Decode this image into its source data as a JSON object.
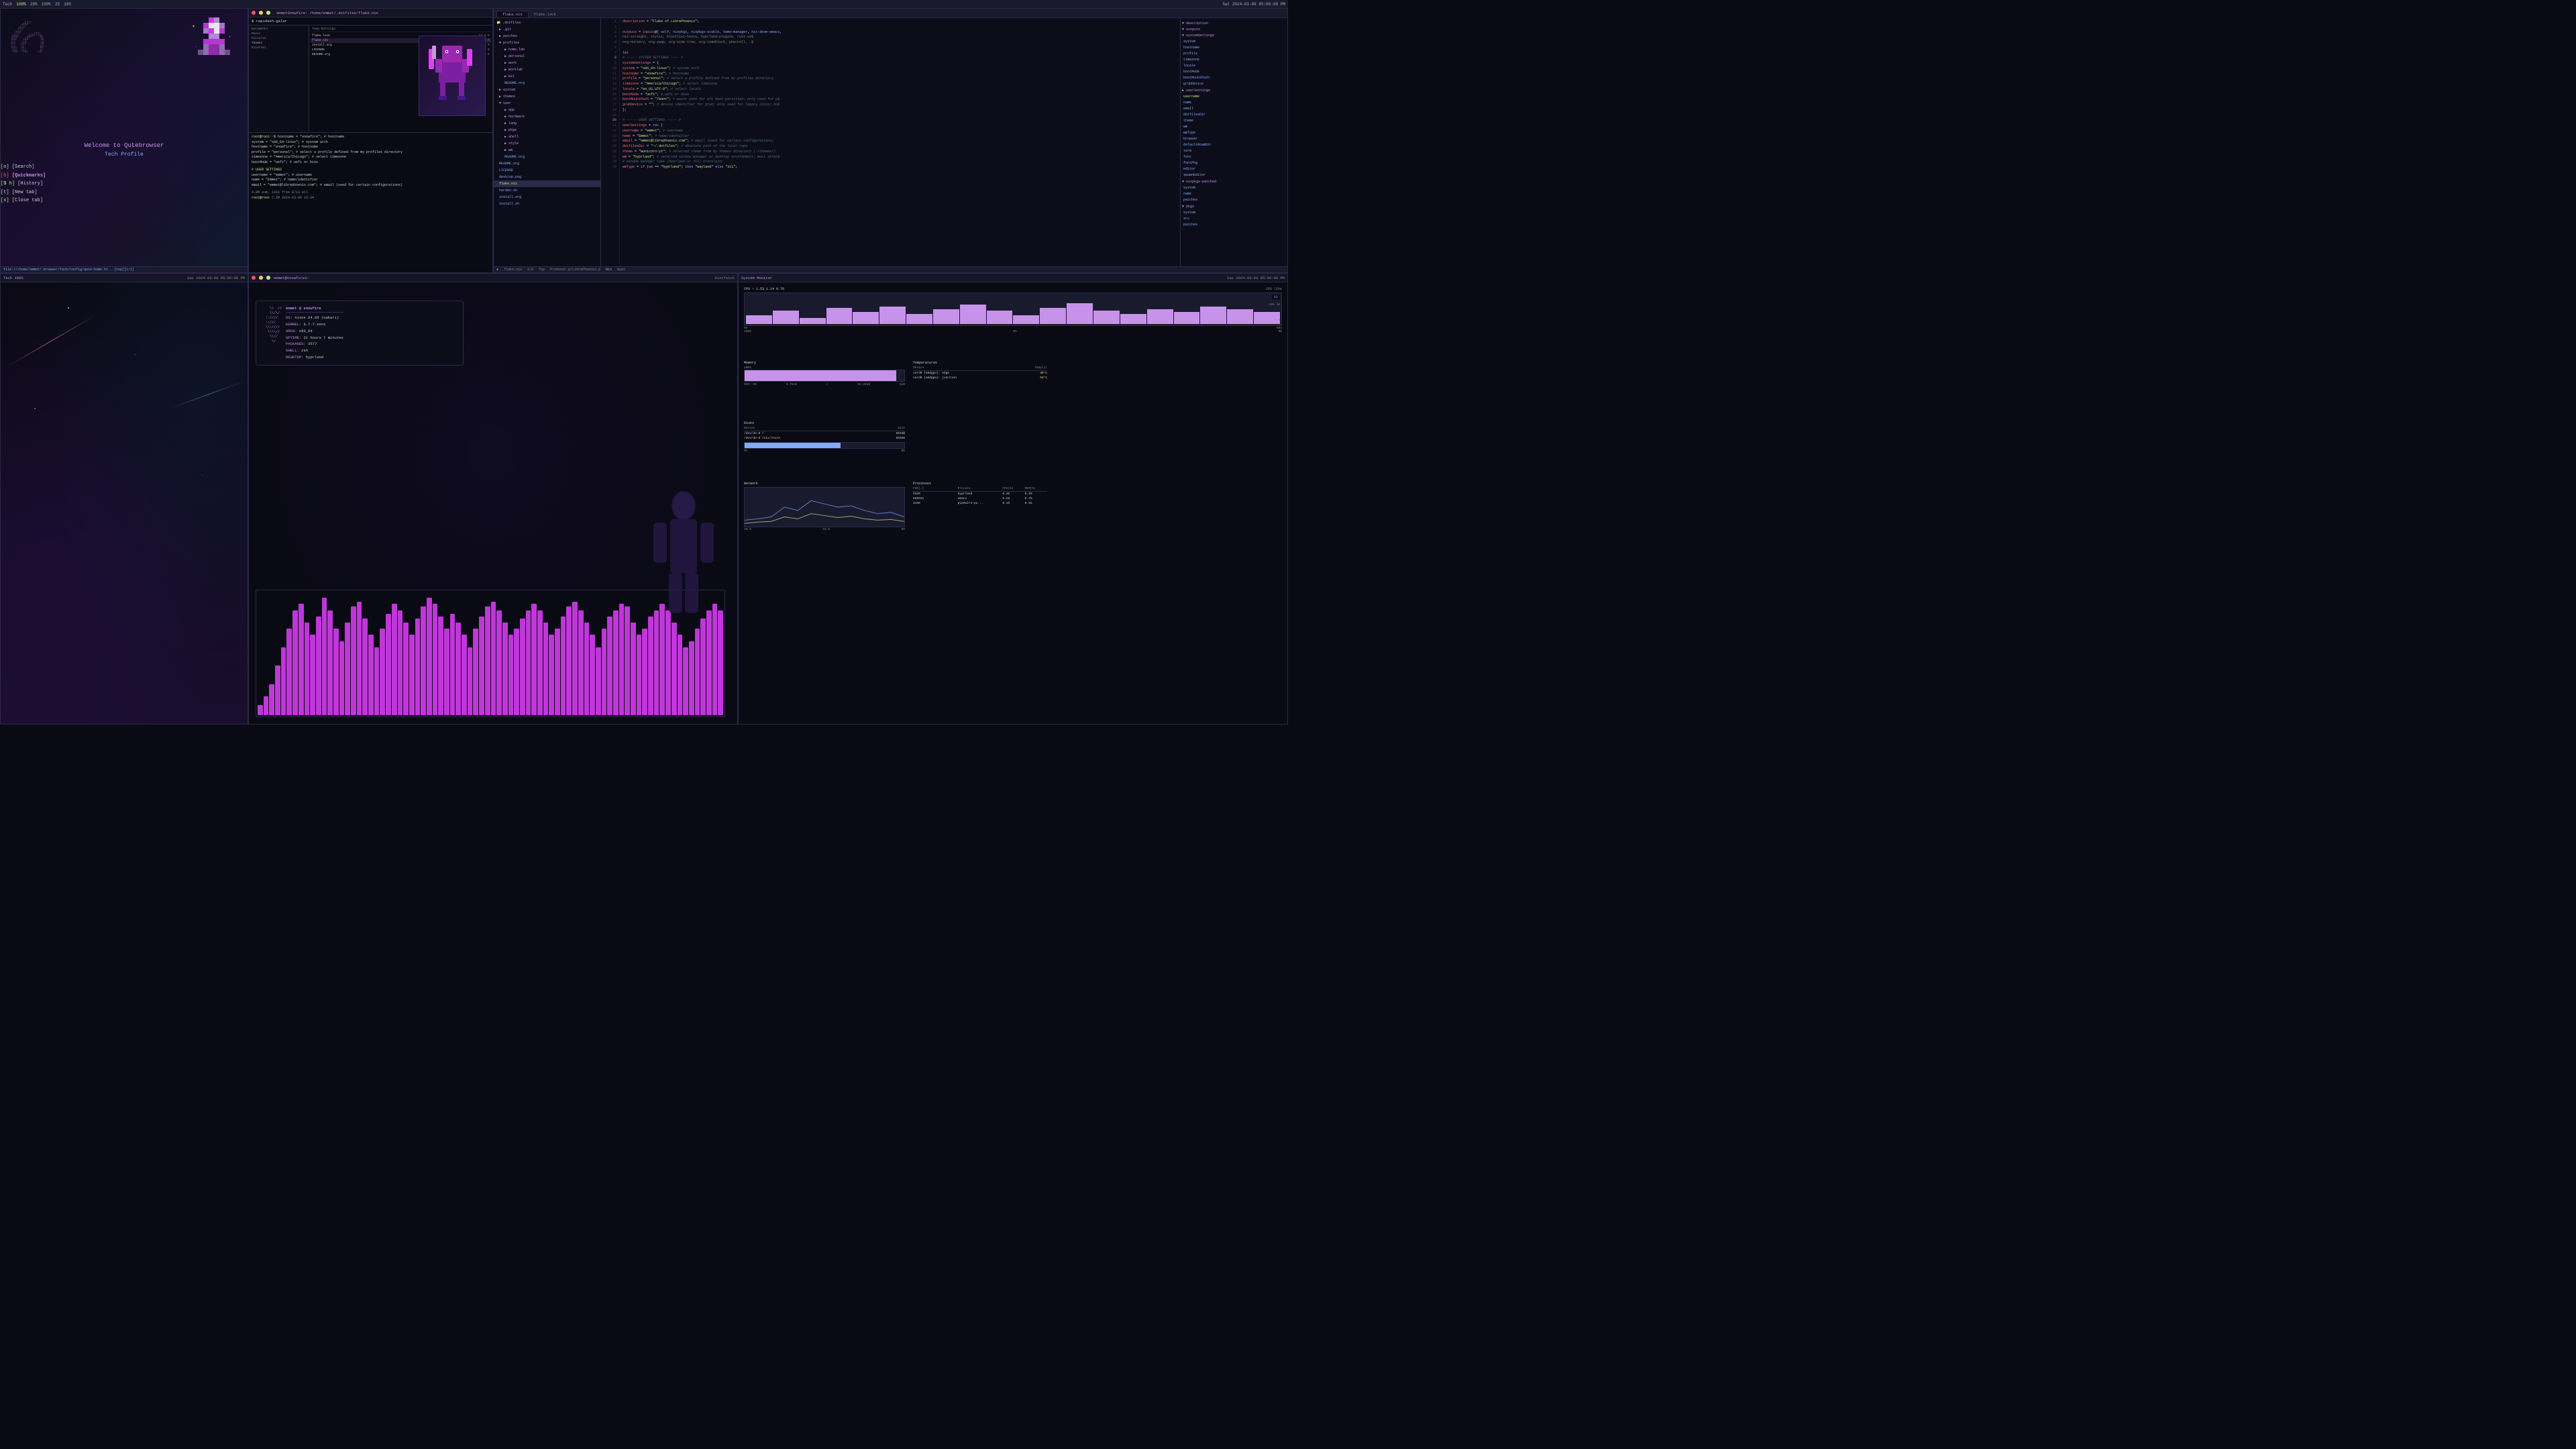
{
  "topbar": {
    "left": {
      "wm": "Tech",
      "battery": "100%",
      "cpu": "29%",
      "memory": "100%",
      "tag1": "2S",
      "tag2": "10S"
    },
    "right": {
      "datetime": "Sat 2024-03-09 05:06:00 PM"
    }
  },
  "qutebrowser": {
    "title": "Qutebrowser",
    "tab": "home.html [top] [1/1]",
    "welcome": "Welcome to Qutebrowser",
    "profile": "Tech Profile",
    "menu": [
      {
        "key": "[o]",
        "label": "[Search]"
      },
      {
        "key": "[b]",
        "label": "[Quickmarks]"
      },
      {
        "key": "[S h]",
        "label": "[History]"
      },
      {
        "key": "[t]",
        "label": "[New tab]"
      },
      {
        "key": "[x]",
        "label": "[Close tab]"
      }
    ],
    "status": "file:///home/emmet/.browser/Tech/config/qute-home.ht...[top][1/1]"
  },
  "filemanager": {
    "title": "emmetSnowfire: /home/emmet/.dotfiles/flake.nix",
    "toolbar_cmd": "rapidash-galar",
    "sidebar": [
      {
        "name": "Documents",
        "type": "folder"
      },
      {
        "name": "Music",
        "type": "folder"
      },
      {
        "name": "Pictures",
        "type": "folder"
      },
      {
        "name": "Themes",
        "type": "folder"
      },
      {
        "name": "External",
        "type": "folder"
      }
    ],
    "breadcrumb": "Temp-Settings",
    "files": [
      {
        "name": "flake.lock",
        "size": "27.5 K",
        "selected": false
      },
      {
        "name": "flake.nix",
        "size": "2.26 K",
        "selected": true
      },
      {
        "name": "install.org",
        "size": "10.6 K",
        "selected": false
      },
      {
        "name": "LICENSE",
        "size": "34.2 K",
        "selected": false
      },
      {
        "name": "README.org",
        "size": "14.9 K",
        "selected": false
      }
    ],
    "terminal": {
      "user": "root",
      "hostname": "root",
      "path": "7.2M",
      "datetime": "2024-03-09 16:34",
      "disk_usage": "4.0M sum, 131k free  8/13  All"
    }
  },
  "editor": {
    "tabs": [
      {
        "label": "flake.nix",
        "active": true
      },
      {
        "label": "flake.lock",
        "active": false
      }
    ],
    "filetree": {
      "root": ".dotfiles",
      "items": [
        {
          "name": ".git",
          "type": "folder",
          "indent": 1
        },
        {
          "name": "patches",
          "type": "folder",
          "indent": 1
        },
        {
          "name": "profiles",
          "type": "folder",
          "indent": 1
        },
        {
          "name": "home.lab",
          "type": "folder",
          "indent": 2
        },
        {
          "name": "personal",
          "type": "folder",
          "indent": 2
        },
        {
          "name": "work",
          "type": "folder",
          "indent": 2
        },
        {
          "name": "worklab",
          "type": "folder",
          "indent": 2
        },
        {
          "name": "wsl",
          "type": "folder",
          "indent": 2
        },
        {
          "name": "README.org",
          "type": "file",
          "indent": 2
        },
        {
          "name": "system",
          "type": "folder",
          "indent": 1
        },
        {
          "name": "themes",
          "type": "folder",
          "indent": 1
        },
        {
          "name": "user",
          "type": "folder",
          "indent": 1
        },
        {
          "name": "app",
          "type": "folder",
          "indent": 2
        },
        {
          "name": "hardware",
          "type": "folder",
          "indent": 2
        },
        {
          "name": "lang",
          "type": "folder",
          "indent": 2
        },
        {
          "name": "pkgs",
          "type": "folder",
          "indent": 2
        },
        {
          "name": "shell",
          "type": "folder",
          "indent": 2
        },
        {
          "name": "style",
          "type": "folder",
          "indent": 2
        },
        {
          "name": "wm",
          "type": "folder",
          "indent": 2
        },
        {
          "name": "README.org",
          "type": "file",
          "indent": 2
        },
        {
          "name": "LICENSE",
          "type": "file",
          "indent": 1
        },
        {
          "name": "README.org",
          "type": "file",
          "indent": 1
        },
        {
          "name": "desktop.png",
          "type": "file",
          "indent": 1
        },
        {
          "name": "flake.nix",
          "type": "file",
          "indent": 1,
          "active": true
        },
        {
          "name": "harden.sh",
          "type": "file",
          "indent": 1
        },
        {
          "name": "install.org",
          "type": "file",
          "indent": 1
        },
        {
          "name": "install.sh",
          "type": "file",
          "indent": 1
        }
      ]
    },
    "code": {
      "lines": [
        {
          "num": 1,
          "content": "  description = \"Flake of LibrePhoenix\";"
        },
        {
          "num": 2,
          "content": ""
        },
        {
          "num": 3,
          "content": "  outputs = inputs@{ self, nixpkgs, nixpkgs-stable, home-manager, nix-doom-emacs,"
        },
        {
          "num": 4,
          "content": "    nix-straight, stylix, blocklist-hosts, hyprland-plugins, rust-ov$"
        },
        {
          "num": 5,
          "content": "    org-nursery, org-yaap, org-side-tree, org-timeblock, phscroll, .$"
        },
        {
          "num": 6,
          "content": ""
        },
        {
          "num": 7,
          "content": "  let"
        },
        {
          "num": 8,
          "content": "    # ----- SYSTEM SETTINGS ---- #"
        },
        {
          "num": 9,
          "content": "    systemSettings = {"
        },
        {
          "num": 10,
          "content": "      system = \"x86_64-linux\"; # system arch"
        },
        {
          "num": 11,
          "content": "      hostname = \"snowfire\"; # hostname"
        },
        {
          "num": 12,
          "content": "      profile = \"personal\"; # select a profile defined from my profiles directory"
        },
        {
          "num": 13,
          "content": "      timezone = \"America/Chicago\"; # select timezone"
        },
        {
          "num": 14,
          "content": "      locale = \"en_US.UTF-8\"; # select locale"
        },
        {
          "num": 15,
          "content": "      bootMode = \"uefi\"; # uefi or bios"
        },
        {
          "num": 16,
          "content": "      bootMountPath = \"/boot\"; # mount path for efi boot partition; only used for u$"
        },
        {
          "num": 17,
          "content": "      grubDevice = \"\"; # device identifier for grub; only used for legacy (bios) bo$"
        },
        {
          "num": 18,
          "content": "    };"
        },
        {
          "num": 19,
          "content": ""
        },
        {
          "num": 20,
          "content": "    # ----- USER SETTINGS ----- #"
        },
        {
          "num": 21,
          "content": "    userSettings = rec {"
        },
        {
          "num": 22,
          "content": "      username = \"emmet\"; # username"
        },
        {
          "num": 23,
          "content": "      name = \"Emmet\"; # name/identifier"
        },
        {
          "num": 24,
          "content": "      email = \"emmet@librephoenix.com\"; # email (used for certain configurations)"
        },
        {
          "num": 25,
          "content": "      dotfilesDir = \"~/.dotfiles\"; # absolute path of the local repo"
        },
        {
          "num": 26,
          "content": "      theme = \"wunicorn-yt\"; # selected theme from my themes directory (./themes/)"
        },
        {
          "num": 27,
          "content": "      wm = \"hyprland\"; # selected window manager or desktop environment; must selec$"
        },
        {
          "num": 28,
          "content": "      # window manager type (hyprland or x11) translator"
        },
        {
          "num": 29,
          "content": "      wmType = if (wm == \"hyprland\") then \"wayland\" else \"x11\";"
        }
      ]
    },
    "right_panel": {
      "sections": [
        {
          "name": "description",
          "label": "▼ description"
        },
        {
          "name": "outputs",
          "label": "▼ outputs"
        },
        {
          "name": "systemSettings",
          "label": "▼ systemSettings",
          "children": [
            "system",
            "hostname",
            "profile",
            "timezone",
            "locale",
            "bootMode",
            "bootMountPath",
            "grubDevice"
          ]
        },
        {
          "name": "userSettings",
          "label": "▶ userSettings",
          "children": [
            "username",
            "name",
            "email",
            "dotfilesDir",
            "theme",
            "wm",
            "wmType",
            "browser",
            "defaultRoamDir",
            "term",
            "font",
            "fontPkg",
            "editor",
            "spawnEditor"
          ]
        },
        {
          "name": "nixpkgs-patched",
          "label": "▼ nixpkgs-patched",
          "children": [
            "system",
            "name",
            "patches"
          ]
        },
        {
          "name": "pkgs",
          "label": "▼ pkgs",
          "children": [
            "system",
            "src",
            "patches"
          ]
        }
      ]
    },
    "status": {
      "file": "flake.nix",
      "position": "3:0",
      "mode": "Top",
      "producer": "Producer.p/LibrePhoenix.p",
      "filetype": "Nix",
      "branch": "main"
    }
  },
  "neofetch": {
    "title": "emmet@snowfire1:",
    "user": "emmet @ snowfire",
    "os": "nixos 24.05 (uakari)",
    "kernel": "6.7.7-zen1",
    "arch": "x86_64",
    "uptime": "21 hours 7 minutes",
    "packages": "3577",
    "shell": "zsh",
    "desktop": "hyprland",
    "ascii_art": [
      "   \\\\  // ",
      "   \\\\//  ",
      " ::::::////  ",
      " :::::::////  ",
      " \\\\:::://///  ",
      "  \\\\\\\\::////  ",
      "   \\\\\\\\////  ",
      "    \\\\////  "
    ]
  },
  "visualizer": {
    "bars": [
      8,
      15,
      25,
      40,
      55,
      70,
      85,
      90,
      75,
      65,
      80,
      95,
      85,
      70,
      60,
      75,
      88,
      92,
      78,
      65,
      55,
      70,
      82,
      90,
      85,
      75,
      65,
      78,
      88,
      95,
      90,
      80,
      70,
      82,
      75,
      65,
      55,
      70,
      80,
      88,
      92,
      85,
      75,
      65,
      70,
      78,
      85,
      90,
      85,
      75,
      65,
      70,
      80,
      88,
      92,
      85,
      75,
      65,
      55,
      70,
      80,
      85,
      90,
      88,
      75,
      65,
      70,
      80,
      85,
      90,
      85,
      75,
      65,
      55,
      60,
      70,
      78,
      85,
      90,
      85
    ],
    "color": "#e040fb"
  },
  "sysmon": {
    "cpu": {
      "label": "CPU",
      "current": "1.53",
      "low": "1.14",
      "high": "0.78",
      "percent": 65,
      "avg": 13,
      "min": 0,
      "max": 8,
      "time_labels": [
        "0s",
        "60s"
      ],
      "percent_labels": [
        "100%",
        "0%"
      ],
      "cpu_like_label": "CPU like"
    },
    "memory": {
      "label": "Memory",
      "percent": 95,
      "used": "5.7618",
      "total": "02.2018",
      "unit": "GiB",
      "time_labels": [
        "0s",
        "0%"
      ],
      "percent_labels": [
        "100%",
        "0%"
      ]
    },
    "temperatures": {
      "label": "Temperatures",
      "devices": [
        {
          "name": "card0 (amdgpu): edge",
          "temp": "49°C"
        },
        {
          "name": "card0 (amdgpu): junction",
          "temp": "58°C"
        }
      ]
    },
    "disks": {
      "label": "Disks",
      "devices": [
        {
          "name": "/dev/de-0 /",
          "size": "504GB"
        },
        {
          "name": "/dev/de-0 /nix/store",
          "size": "503GB"
        }
      ]
    },
    "network": {
      "label": "Network",
      "values": [
        "36.0",
        "10.5",
        "0%"
      ]
    },
    "processes": {
      "label": "Processes",
      "headers": [
        "Process",
        "CPU(%)",
        "MEM(%)"
      ],
      "items": [
        {
          "name": "Hyprland",
          "pid": "2520",
          "cpu": "0.35",
          "mem": "0.4%"
        },
        {
          "name": "emacs",
          "pid": "550631",
          "cpu": "0.20",
          "mem": "0.7%"
        },
        {
          "name": "pipewire-pu...",
          "pid": "3150",
          "cpu": "0.15",
          "mem": "0.1%"
        }
      ]
    }
  }
}
